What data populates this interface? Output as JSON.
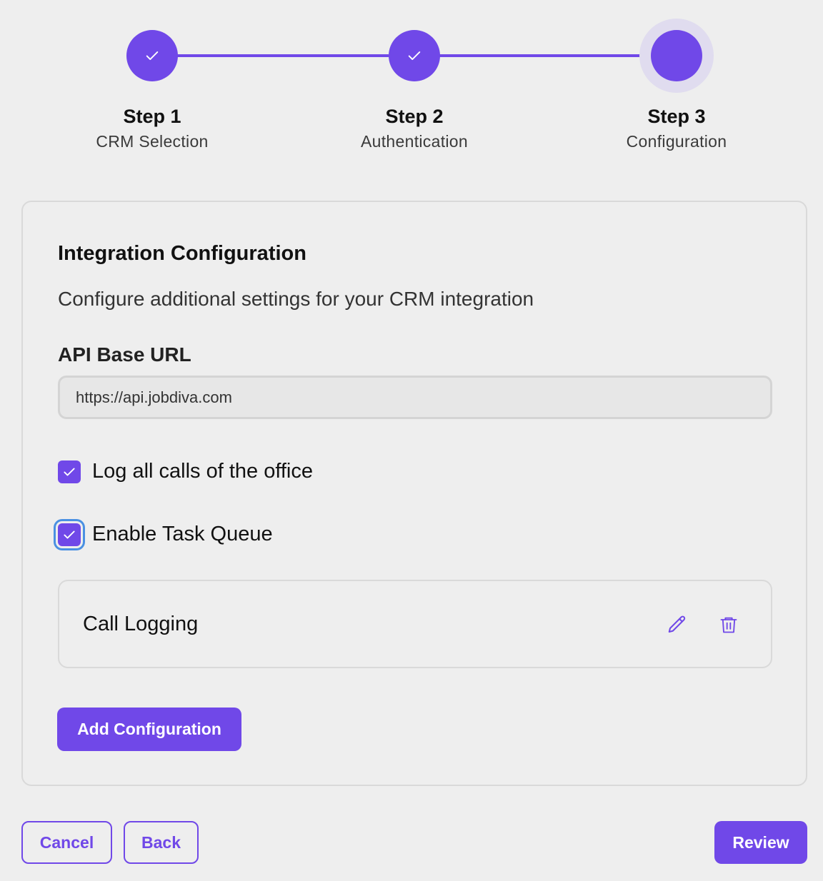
{
  "colors": {
    "accent": "#7048e8",
    "background": "#eeeeee",
    "focus_ring": "#4a90e2"
  },
  "stepper": {
    "steps": [
      {
        "title": "Step 1",
        "subtitle": "CRM Selection",
        "state": "completed",
        "icon": "check-icon"
      },
      {
        "title": "Step 2",
        "subtitle": "Authentication",
        "state": "completed",
        "icon": "check-icon"
      },
      {
        "title": "Step 3",
        "subtitle": "Configuration",
        "state": "current"
      }
    ]
  },
  "card": {
    "title": "Integration Configuration",
    "description": "Configure additional settings for your CRM integration",
    "api_url": {
      "label": "API Base URL",
      "value": "https://api.jobdiva.com"
    },
    "checkboxes": [
      {
        "label": "Log all calls of the office",
        "checked": true
      },
      {
        "label": "Enable Task Queue",
        "checked": true,
        "focused": true
      }
    ],
    "configurations": [
      {
        "name": "Call Logging",
        "actions": [
          "pencil-icon",
          "trash-icon"
        ]
      }
    ],
    "add_button_label": "Add Configuration"
  },
  "footer": {
    "cancel_label": "Cancel",
    "back_label": "Back",
    "review_label": "Review"
  }
}
